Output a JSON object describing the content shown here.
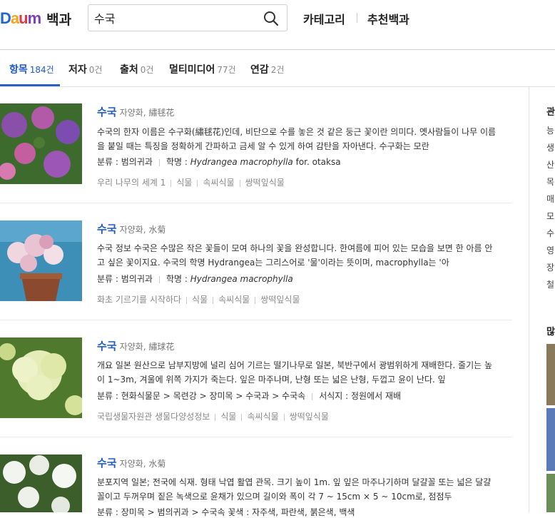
{
  "header": {
    "logo_letters": [
      "D",
      "a",
      "u",
      "m"
    ],
    "logo_title": "백과",
    "search_value": "수국",
    "links": [
      "카테고리",
      "추천백과"
    ]
  },
  "tabs": [
    {
      "label": "항목",
      "count": "184건"
    },
    {
      "label": "저자",
      "count": "0건"
    },
    {
      "label": "출처",
      "count": "0건"
    },
    {
      "label": "멀티미디어",
      "count": "77건"
    },
    {
      "label": "연감",
      "count": "2건"
    }
  ],
  "results": [
    {
      "title": "수국",
      "subtitle": "자양화, 繡毬花",
      "desc": "수국의 한자 이름은 수구화(繡毬花)인데, 비단으로 수를 놓은 것 같은 둥근 꽃이란 의미다. 옛사람들이 나무 이름을 붙일 때는 특징을 정확하게 간파하고 금세 알 수 있게 하여 감탄을 자아낸다. 수구화는 모란",
      "meta": [
        {
          "label": "분류 : ",
          "value": "범의귀과"
        },
        {
          "label": "학명 : ",
          "value": "Hydrangea macrophylla",
          "extra": " for. otaksa"
        }
      ],
      "tags": [
        "우리 나무의 세계 1",
        "식물",
        "속씨식물",
        "쌍떡잎식물"
      ]
    },
    {
      "title": "수국",
      "subtitle": "자양화, 水菊",
      "desc": "수국 정보 수국은 수많은 작은 꽃들이 모여 하나의 꽃을 완성합니다. 한여름에 피어 있는 모습을 보면 한 아름 안고 싶은 꽃이지요. 수국의 학명 Hydrangea는 그리스어로 '물'이라는 뜻이며, macrophylla는 '아",
      "meta": [
        {
          "label": "분류 : ",
          "value": "범의귀과"
        },
        {
          "label": "학명 : ",
          "value": "Hydrangea macrophylla",
          "extra": ""
        }
      ],
      "tags": [
        "화초 기르기를 시작하다",
        "식물",
        "속씨식물",
        "쌍떡잎식물"
      ]
    },
    {
      "title": "수국",
      "subtitle": "자양화, 繡球花",
      "desc": "개요 일본 원산으로 남부지방에 널리 심어 기르는 떨기나무로 일본, 북반구에서 광범위하게 재배한다. 줄기는 높이 1~3m, 겨울에 위쪽 가지가 죽는다. 잎은 마주나며, 난형 또는 넓은 난형, 두껍고 윤이 난다. 잎",
      "meta": [
        {
          "label": "분류 : ",
          "value": "현화식물문 > 목련강 > 장미목 > 수국과 > 수국속"
        },
        {
          "label": "서식지 : ",
          "value": "정원에서 재배",
          "extra": ""
        }
      ],
      "tags": [
        "국립생물자원관 생물다양성정보",
        "식물",
        "속씨식물",
        "쌍떡잎식물"
      ]
    },
    {
      "title": "수국",
      "subtitle": "자양화, 水菊",
      "desc": "분포지역 일본; 전국에 식재. 형태 낙엽 활엽 관목. 크기 높이 1m. 잎 잎은 마주나기하며 달걀꼴 또는 넓은 달걀꼴이고 두꺼우며 짙은 녹색으로 윤채가 있으며 길이와 폭이 각 7 ~ 15cm × 5 ~ 10cm로, 점점두",
      "meta_text": "분류 : 장미목 > 범의귀과 > 수국속   꽃색 : 자주색, 파란색, 붉은색, 백색"
    }
  ],
  "sidebar": {
    "heading": "관",
    "items": [
      "능",
      "생",
      "산",
      "목",
      "매",
      "모",
      "수",
      "영",
      "장",
      "철"
    ],
    "heading2": "많"
  },
  "colors": {
    "accent": "#1e5bc6",
    "tab_underline": "#2b5ec8"
  }
}
